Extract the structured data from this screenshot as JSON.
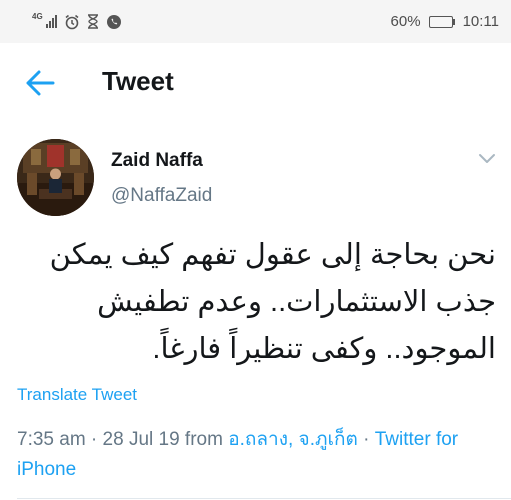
{
  "status_bar": {
    "network_label": "4G",
    "battery_percent": "60%",
    "battery_level": 0.6,
    "time": "10:11",
    "icons": [
      "signal-icon",
      "alarm-icon",
      "hourglass-icon",
      "whatsapp-icon",
      "battery-icon"
    ]
  },
  "header": {
    "back_icon": "arrow-left-icon",
    "title": "Tweet"
  },
  "tweet": {
    "author_name": "Zaid Naffa",
    "author_handle": "@NaffaZaid",
    "text": "نحن بحاجة إلى عقول تفهم كيف يمكن جذب الاستثمارات.. وعدم تطفيش الموجود.. وكفى تنظيراً فارغاً.",
    "translate_label": "Translate Tweet",
    "timestamp": "7:35 am · 28 Jul 19 from",
    "location": "อ.ถลาง, จ.ภูเก็ต",
    "separator": "·",
    "source": "Twitter for iPhone"
  },
  "colors": {
    "accent": "#1da1f2",
    "text": "#14171a",
    "muted": "#657786",
    "status_bar_bg": "#f5f5f5"
  }
}
